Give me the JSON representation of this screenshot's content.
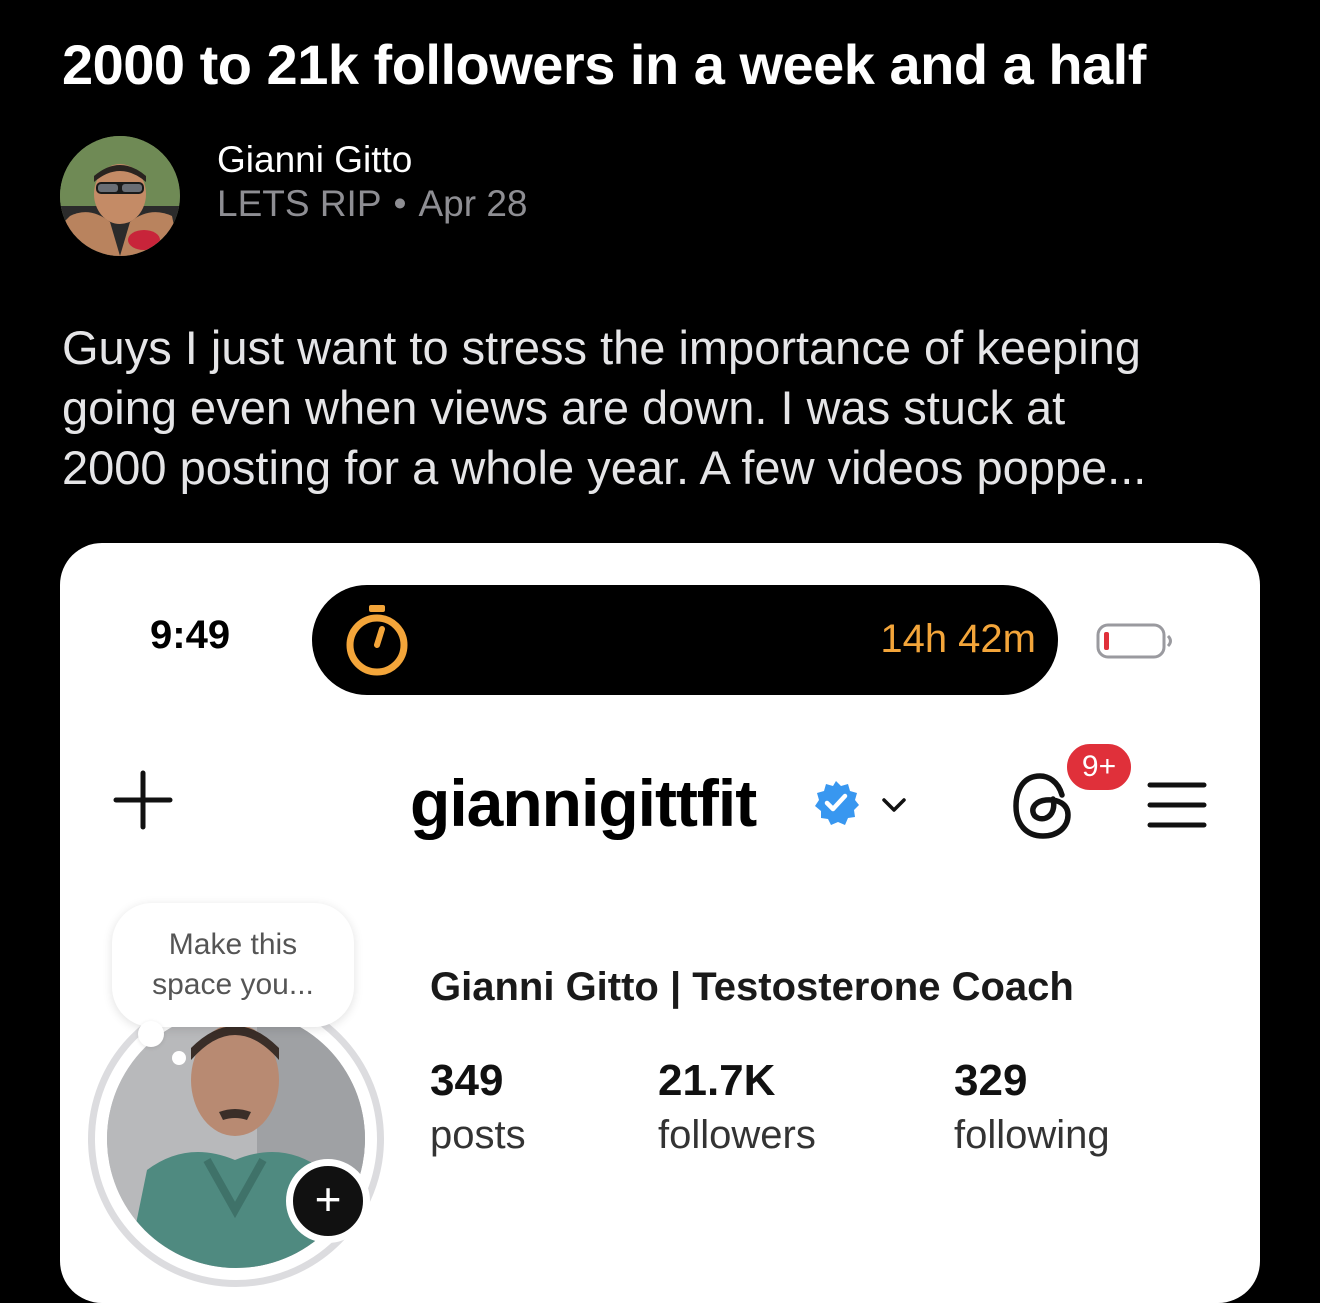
{
  "post": {
    "title": "2000 to 21k followers in a week and a half",
    "author_name": "Gianni Gitto",
    "community": "LETS RIP",
    "separator": "•",
    "date": "Apr 28",
    "body_lines": [
      "Guys I just want to stress the importance of keeping",
      "going even when views are down. I was stuck at",
      "2000 posting for a whole year. A few videos poppe..."
    ]
  },
  "screenshot": {
    "status_time": "9:49",
    "timer_value": "14h 42m",
    "header": {
      "username": "giannigittfit",
      "notification_badge": "9+"
    },
    "note_bubble": {
      "line1": "Make this",
      "line2": "space you..."
    },
    "add_story_symbol": "+",
    "profile": {
      "full_name": "Gianni Gitto | Testosterone Coach",
      "stats": [
        {
          "value": "349",
          "label": "posts"
        },
        {
          "value": "21.7K",
          "label": "followers"
        },
        {
          "value": "329",
          "label": "following"
        }
      ]
    }
  },
  "icons": {
    "add": "plus-icon",
    "verified": "verified-badge-icon",
    "chevron": "chevron-down-icon",
    "threads": "threads-icon",
    "menu": "hamburger-menu-icon",
    "timer": "stopwatch-icon",
    "battery": "battery-icon"
  },
  "colors": {
    "background": "#000000",
    "meta_gray": "#8e8e93",
    "timer_orange": "#f3a53a",
    "verified_blue": "#3897f0",
    "badge_red": "#e0303a",
    "battery_red": "#e0303a"
  }
}
